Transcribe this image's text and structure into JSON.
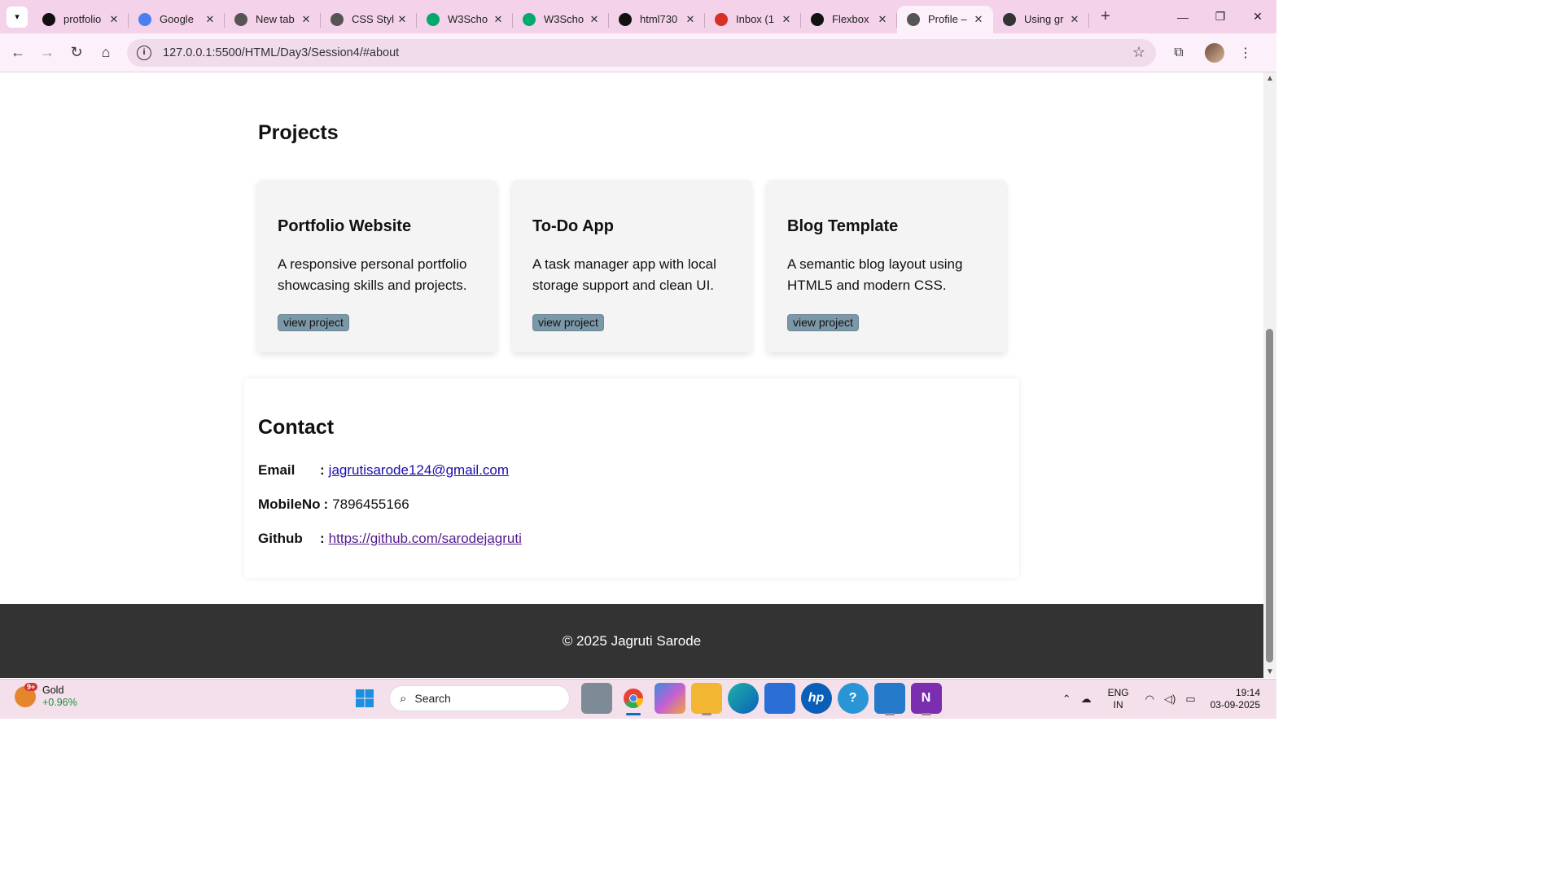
{
  "browser": {
    "tabs": [
      {
        "title": "protfolio",
        "icon": "github-icon",
        "color": "#111111",
        "active": false
      },
      {
        "title": "Google",
        "icon": "gemini-icon",
        "color": "#4b7ff0",
        "active": false
      },
      {
        "title": "New tab",
        "icon": "chrome-icon",
        "color": "#555555",
        "active": false
      },
      {
        "title": "CSS Styl",
        "icon": "globe-icon",
        "color": "#555555",
        "active": false
      },
      {
        "title": "W3Scho",
        "icon": "w3schools-icon",
        "color": "#04aa6d",
        "active": false
      },
      {
        "title": "W3Scho",
        "icon": "w3schools-icon",
        "color": "#04aa6d",
        "active": false
      },
      {
        "title": "html730",
        "icon": "github-icon",
        "color": "#111111",
        "active": false
      },
      {
        "title": "Inbox (1",
        "icon": "gmail-icon",
        "color": "#d93025",
        "active": false
      },
      {
        "title": "Flexbox",
        "icon": "medium-icon",
        "color": "#111111",
        "active": false
      },
      {
        "title": "Profile –",
        "icon": "globe-icon",
        "color": "#555555",
        "active": true
      },
      {
        "title": "Using gr",
        "icon": "openai-icon",
        "color": "#333333",
        "active": false
      }
    ],
    "url": "127.0.0.1:5500/HTML/Day3/Session4/#about"
  },
  "page": {
    "projects_title": "Projects",
    "projects": [
      {
        "title": "Portfolio Website",
        "description": "A responsive personal portfolio showcasing skills and projects.",
        "button": "view project"
      },
      {
        "title": "To-Do App",
        "description": "A task manager app with local storage support and clean UI.",
        "button": "view project"
      },
      {
        "title": "Blog Template",
        "description": "A semantic blog layout using HTML5 and modern CSS.",
        "button": "view project"
      }
    ],
    "contact": {
      "title": "Contact",
      "email_label": "Email",
      "email_value": "jagrutisarode124@gmail.com",
      "mobile_label": "MobileNo",
      "mobile_value": "7896455166",
      "github_label": "Github",
      "github_value": "https://github.com/sarodejagruti",
      "colon": ":"
    },
    "footer": "© 2025 Jagruti Sarode"
  },
  "taskbar": {
    "widget_title": "Gold",
    "widget_change": "+0.96%",
    "widget_badge": "9+",
    "search_placeholder": "Search",
    "lang_top": "ENG",
    "lang_bottom": "IN",
    "time": "19:14",
    "date": "03-09-2025"
  }
}
